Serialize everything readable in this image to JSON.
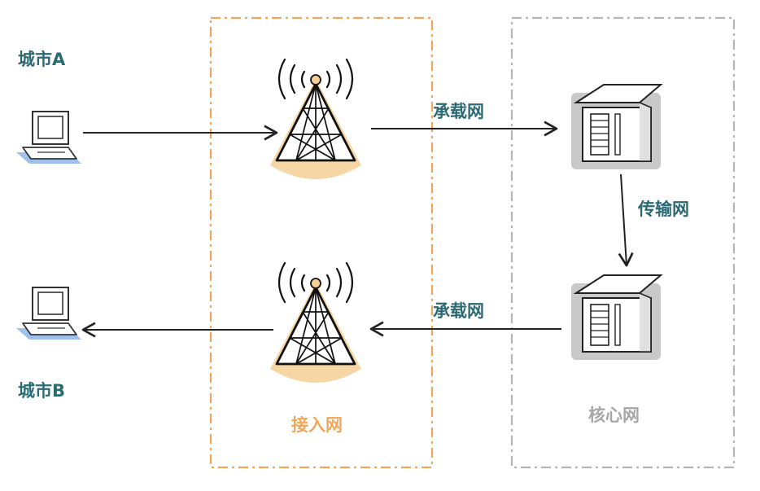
{
  "labels": {
    "city_a": "城市A",
    "city_b": "城市B",
    "bearer_top": "承载网",
    "bearer_bottom": "承载网",
    "transport": "传输网",
    "access_zone": "接入网",
    "core_zone": "核心网"
  },
  "colors": {
    "label_teal": "#2b6a73",
    "access_orange": "#f2a65a",
    "core_gray": "#b5b5b5",
    "laptop_blue": "#9fc0ea",
    "tower_glow": "#f6cf95"
  },
  "icons": {
    "laptop": "laptop-icon",
    "tower": "cell-tower-icon",
    "server": "server-building-icon"
  }
}
